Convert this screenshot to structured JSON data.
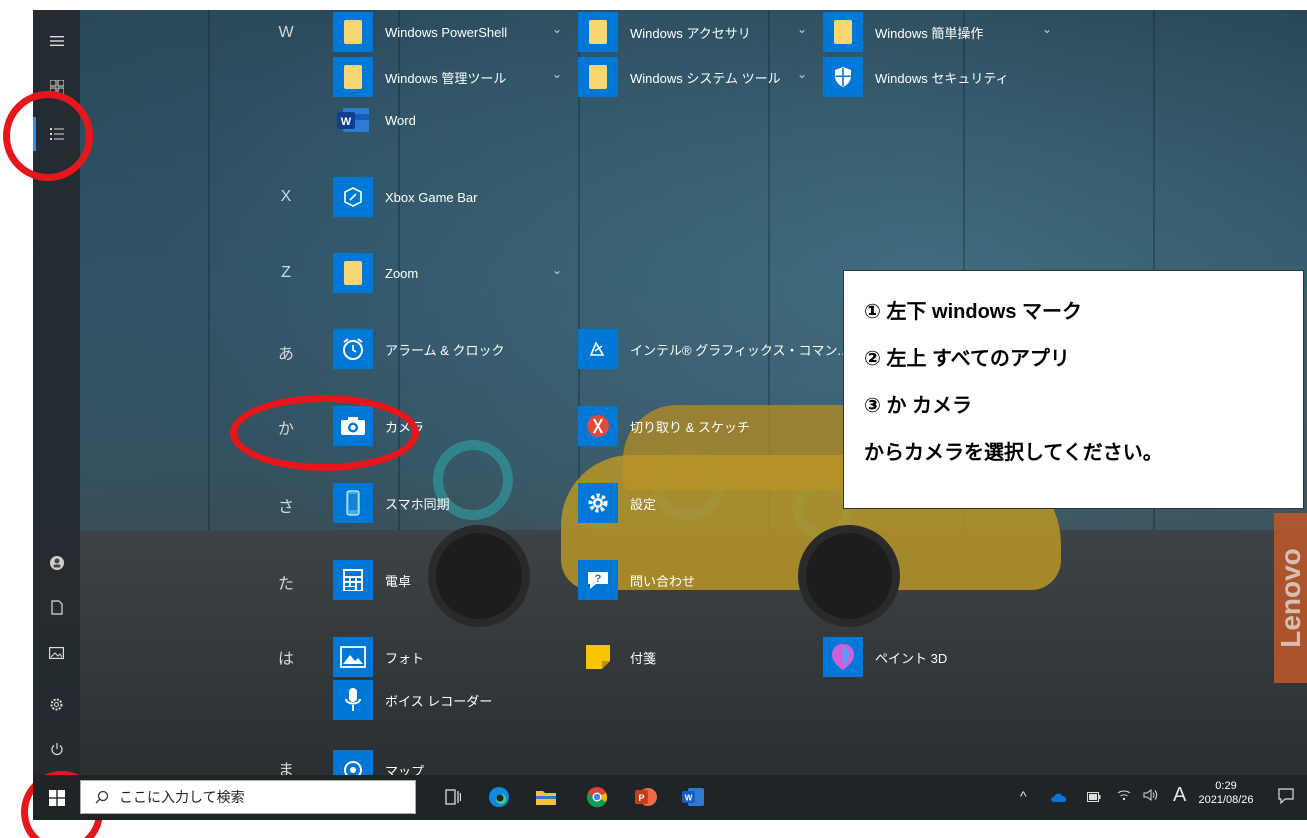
{
  "start_menu": {
    "rail": {
      "items": [
        {
          "icon": "hamburger-menu-icon",
          "label": "≡"
        },
        {
          "icon": "pinned-tiles-icon",
          "label": "▦"
        },
        {
          "icon": "all-apps-list-icon",
          "label": "☰"
        },
        {
          "icon": "user-icon",
          "label": "◉"
        },
        {
          "icon": "document-icon",
          "label": "🗋"
        },
        {
          "icon": "pictures-icon",
          "label": "▭"
        },
        {
          "icon": "settings-gear-icon",
          "label": "⚙"
        },
        {
          "icon": "power-icon",
          "label": "⏻"
        }
      ]
    },
    "letters": {
      "w": "W",
      "x": "X",
      "z": "Z",
      "a": "あ",
      "ka": "か",
      "sa": "さ",
      "ta": "た",
      "ha": "は",
      "ma": "ま"
    },
    "apps": {
      "powershell": "Windows PowerShell",
      "accessories": "Windows アクセサリ",
      "ease_of_access": "Windows 簡単操作",
      "admin_tools": "Windows 管理ツール",
      "system_tools": "Windows システム ツール",
      "security": "Windows セキュリティ",
      "word": "Word",
      "xbox": "Xbox Game Bar",
      "zoom": "Zoom",
      "alarms": "アラーム & クロック",
      "intel": "インテル® グラフィックス・コマン...",
      "camera": "カメラ",
      "snip": "切り取り & スケッチ",
      "phone": "スマホ同期",
      "settings": "設定",
      "calculator": "電卓",
      "help": "問い合わせ",
      "photos": "フォト",
      "sticky": "付箋",
      "paint3d": "ペイント 3D",
      "voice": "ボイス レコーダー",
      "maps": "マップ"
    },
    "chevron": "⌄",
    "word_tile_letter": "W"
  },
  "instructions": {
    "line1": "① 左下 windows マーク",
    "line2": "② 左上 すべてのアプリ",
    "line3": "③ か カメラ",
    "line4": "からカメラを選択してください。"
  },
  "wallpaper": {
    "brand": "Lenovo"
  },
  "taskbar": {
    "search_placeholder": "ここに入力して検索",
    "time": "0:29",
    "date": "2021/08/26",
    "ime": "A",
    "tray_up": "^",
    "volume": "🔈",
    "wifi": "((",
    "battery": "▭",
    "notification": "🗨"
  },
  "colors": {
    "accent_blue": "#0078d7",
    "annotation_red": "#e8151b",
    "folder_yellow": "#f6d774"
  }
}
